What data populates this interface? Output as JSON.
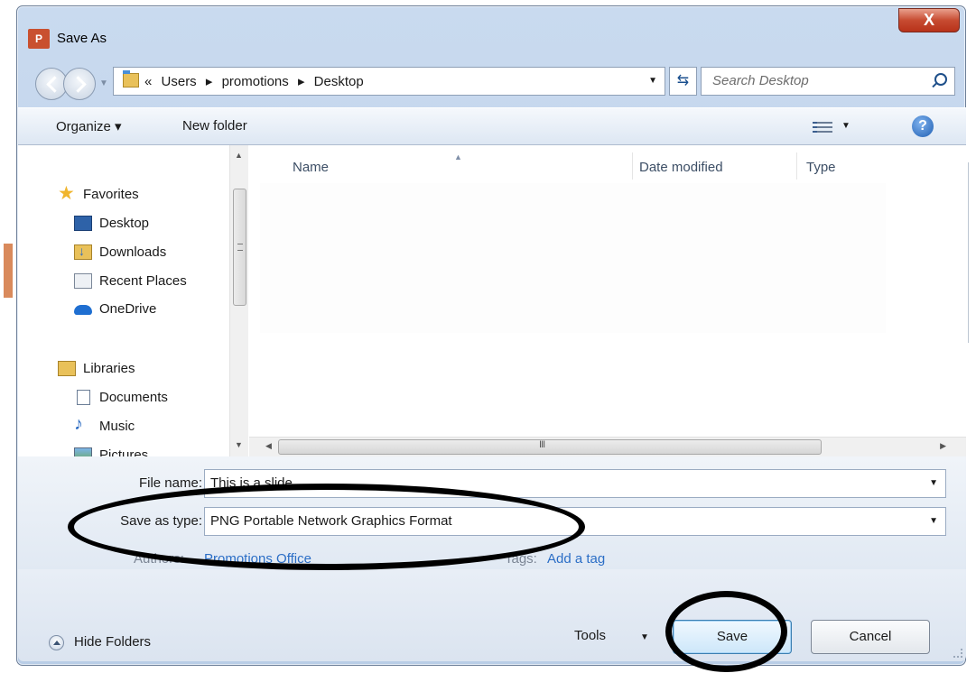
{
  "window": {
    "title": "Save As",
    "close_glyph": "X",
    "app_icon": "P"
  },
  "address": {
    "crumbs": [
      "«",
      "Users",
      "▸",
      "promotions",
      "▸",
      "Desktop"
    ],
    "search_placeholder": "Search Desktop"
  },
  "toolbar": {
    "organize": "Organize ▾",
    "new_folder": "New folder",
    "help": "?"
  },
  "nav_pane": {
    "favorites": "Favorites",
    "desktop": "Desktop",
    "downloads": "Downloads",
    "recent": "Recent Places",
    "onedrive": "OneDrive",
    "libraries": "Libraries",
    "documents": "Documents",
    "music": "Music",
    "pictures": "Pictures"
  },
  "columns": {
    "name": "Name",
    "date": "Date modified",
    "type": "Type"
  },
  "form": {
    "file_name_label": "File name:",
    "file_name_value": "This is a slide",
    "save_type_label": "Save as type:",
    "save_type_value": "PNG Portable Network Graphics Format",
    "authors_label": "Authors:",
    "authors_value": "Promotions Office",
    "tags_label": "Tags:",
    "tags_value": "Add a tag"
  },
  "footer": {
    "hide_folders": "Hide Folders",
    "tools": "Tools",
    "save": "Save",
    "cancel": "Cancel"
  },
  "colors": {
    "accent": "#2b6ec6",
    "dialog_bg": "#c9daef",
    "close": "#c74b31"
  }
}
